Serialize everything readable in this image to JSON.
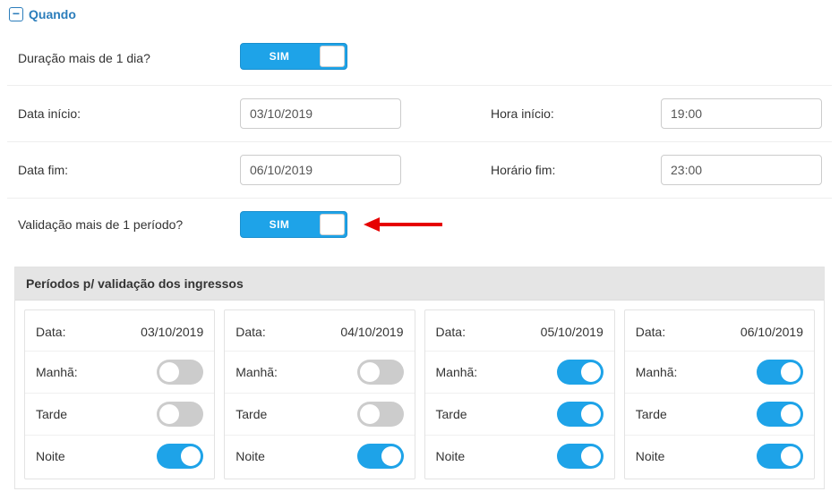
{
  "section": {
    "title": "Quando",
    "collapse_glyph": "−"
  },
  "rows": {
    "duration_label": "Duração mais de 1 dia?",
    "duration_toggle_label": "SIM",
    "date_start_label": "Data início:",
    "date_start_value": "03/10/2019",
    "time_start_label": "Hora início:",
    "time_start_value": "19:00",
    "date_end_label": "Data fim:",
    "date_end_value": "06/10/2019",
    "time_end_label": "Horário fim:",
    "time_end_value": "23:00",
    "validation_label": "Validação mais de 1 período?",
    "validation_toggle_label": "SIM"
  },
  "periods": {
    "header": "Períodos p/ validação dos ingressos",
    "labels": {
      "date": "Data:",
      "morning": "Manhã:",
      "afternoon": "Tarde",
      "night": "Noite"
    },
    "cards": [
      {
        "date": "03/10/2019",
        "morning": false,
        "afternoon": false,
        "night": true
      },
      {
        "date": "04/10/2019",
        "morning": false,
        "afternoon": false,
        "night": true
      },
      {
        "date": "05/10/2019",
        "morning": true,
        "afternoon": true,
        "night": true
      },
      {
        "date": "06/10/2019",
        "morning": true,
        "afternoon": true,
        "night": true
      }
    ]
  }
}
